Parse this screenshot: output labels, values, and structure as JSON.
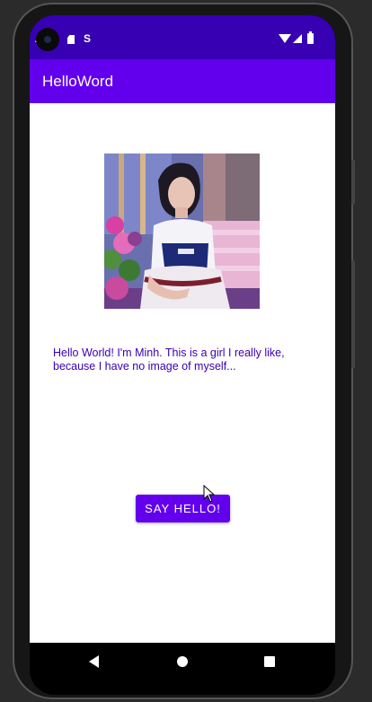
{
  "status_bar": {
    "time": "4",
    "icons": [
      "sd-card-icon",
      "s-icon",
      "wifi-icon",
      "signal-icon",
      "battery-icon"
    ],
    "background": "#3700B3"
  },
  "app_bar": {
    "title": "HelloWord",
    "background": "#6200EE"
  },
  "main": {
    "image_alt": "photo of a girl sitting on a pink bench with flowers",
    "greeting": "Hello World! I'm Minh. This is a girl I really like, because I have no image of myself...",
    "button_label": "SAY HELLO!",
    "text_color": "#3700B3",
    "button_color": "#6200EE"
  },
  "nav_bar": {
    "icons": [
      "back-icon",
      "home-icon",
      "recents-icon"
    ]
  }
}
